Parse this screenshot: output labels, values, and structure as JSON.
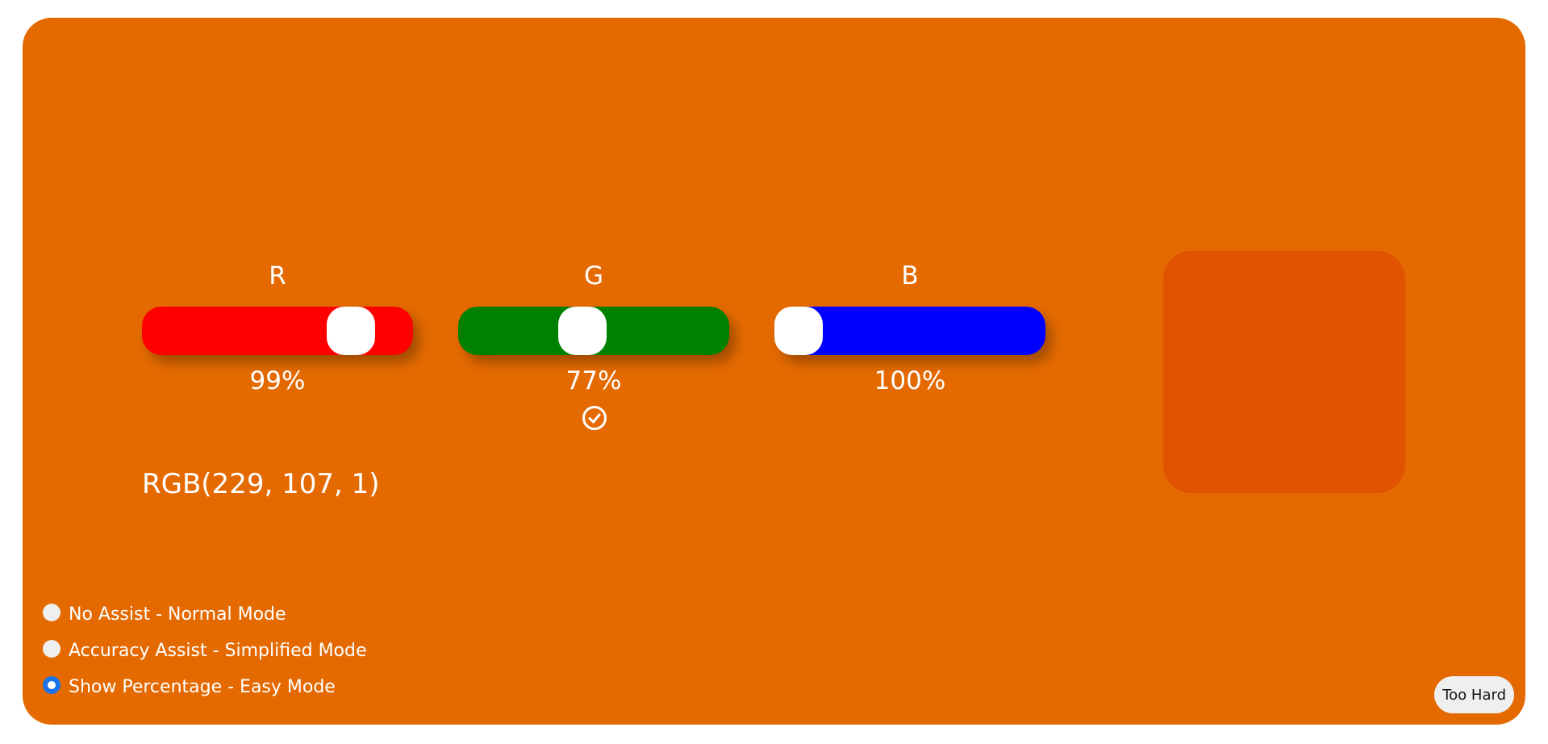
{
  "colors": {
    "panel_background": "#e46a00",
    "swatch": "#e05401",
    "track_r": "#ff0000",
    "track_g": "#008000",
    "track_b": "#0000ff",
    "radio_selected": "#1a73e8"
  },
  "sliders": [
    {
      "label": "R",
      "percent_text": "99%",
      "value": 0.83,
      "check_icon": false
    },
    {
      "label": "G",
      "percent_text": "77%",
      "value": 0.45,
      "check_icon": true
    },
    {
      "label": "B",
      "percent_text": "100%",
      "value": 0.0,
      "check_icon": false
    }
  ],
  "readout": "RGB(229, 107, 1)",
  "modes": [
    {
      "label": "No Assist - Normal Mode",
      "selected": false
    },
    {
      "label": "Accuracy Assist - Simplified Mode",
      "selected": false
    },
    {
      "label": "Show Percentage - Easy Mode",
      "selected": true
    }
  ],
  "too_hard_button": "Too Hard"
}
